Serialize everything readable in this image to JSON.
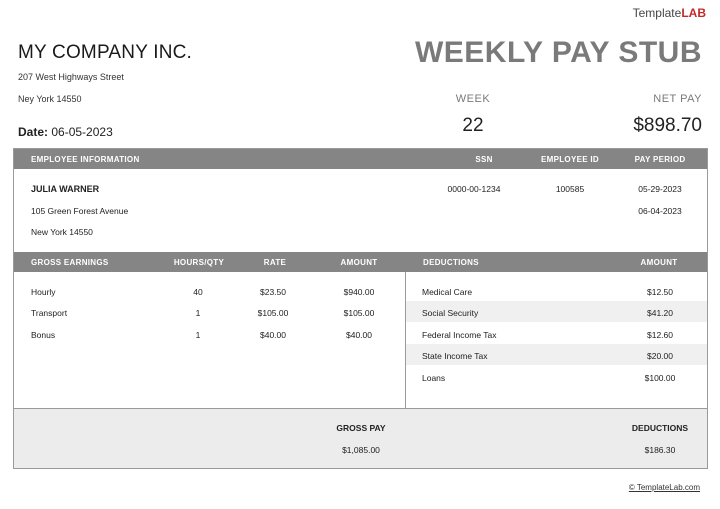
{
  "logo": {
    "prefix": "Template",
    "suffix": "LAB"
  },
  "company": {
    "name": "MY COMPANY INC.",
    "address_line1": "207 West Highways Street",
    "address_line2": "Ney York 14550"
  },
  "date": {
    "label": "Date:",
    "value": "06-05-2023"
  },
  "title": "WEEKLY PAY STUB",
  "week": {
    "label": "WEEK",
    "value": "22"
  },
  "net_pay": {
    "label": "NET PAY",
    "value": "$898.70"
  },
  "employee_header": {
    "info": "EMPLOYEE INFORMATION",
    "ssn": "SSN",
    "employee_id": "EMPLOYEE ID",
    "pay_period": "PAY PERIOD"
  },
  "employee": {
    "name": "JULIA WARNER",
    "address_line1": "105 Green Forest Avenue",
    "address_line2": "New York 14550",
    "ssn": "0000-00-1234",
    "employee_id": "100585",
    "period_start": "05-29-2023",
    "period_end": "06-04-2023"
  },
  "earnings_header": {
    "gross_earnings": "GROSS EARNINGS",
    "hours": "HOURS/QTY",
    "rate": "RATE",
    "amount": "AMOUNT"
  },
  "earnings": [
    {
      "name": "Hourly",
      "qty": "40",
      "rate": "$23.50",
      "amount": "$940.00"
    },
    {
      "name": "Transport",
      "qty": "1",
      "rate": "$105.00",
      "amount": "$105.00"
    },
    {
      "name": "Bonus",
      "qty": "1",
      "rate": "$40.00",
      "amount": "$40.00"
    }
  ],
  "deductions_header": {
    "deductions": "DEDUCTIONS",
    "amount": "AMOUNT"
  },
  "deductions": [
    {
      "name": "Medical Care",
      "amount": "$12.50"
    },
    {
      "name": "Social Security",
      "amount": "$41.20"
    },
    {
      "name": "Federal Income Tax",
      "amount": "$12.60"
    },
    {
      "name": "State Income Tax",
      "amount": "$20.00"
    },
    {
      "name": "Loans",
      "amount": "$100.00"
    }
  ],
  "totals": {
    "gross_pay_label": "GROSS PAY",
    "gross_pay_value": "$1,085.00",
    "deductions_label": "DEDUCTIONS",
    "deductions_value": "$186.30"
  },
  "credit": "© TemplateLab.com"
}
